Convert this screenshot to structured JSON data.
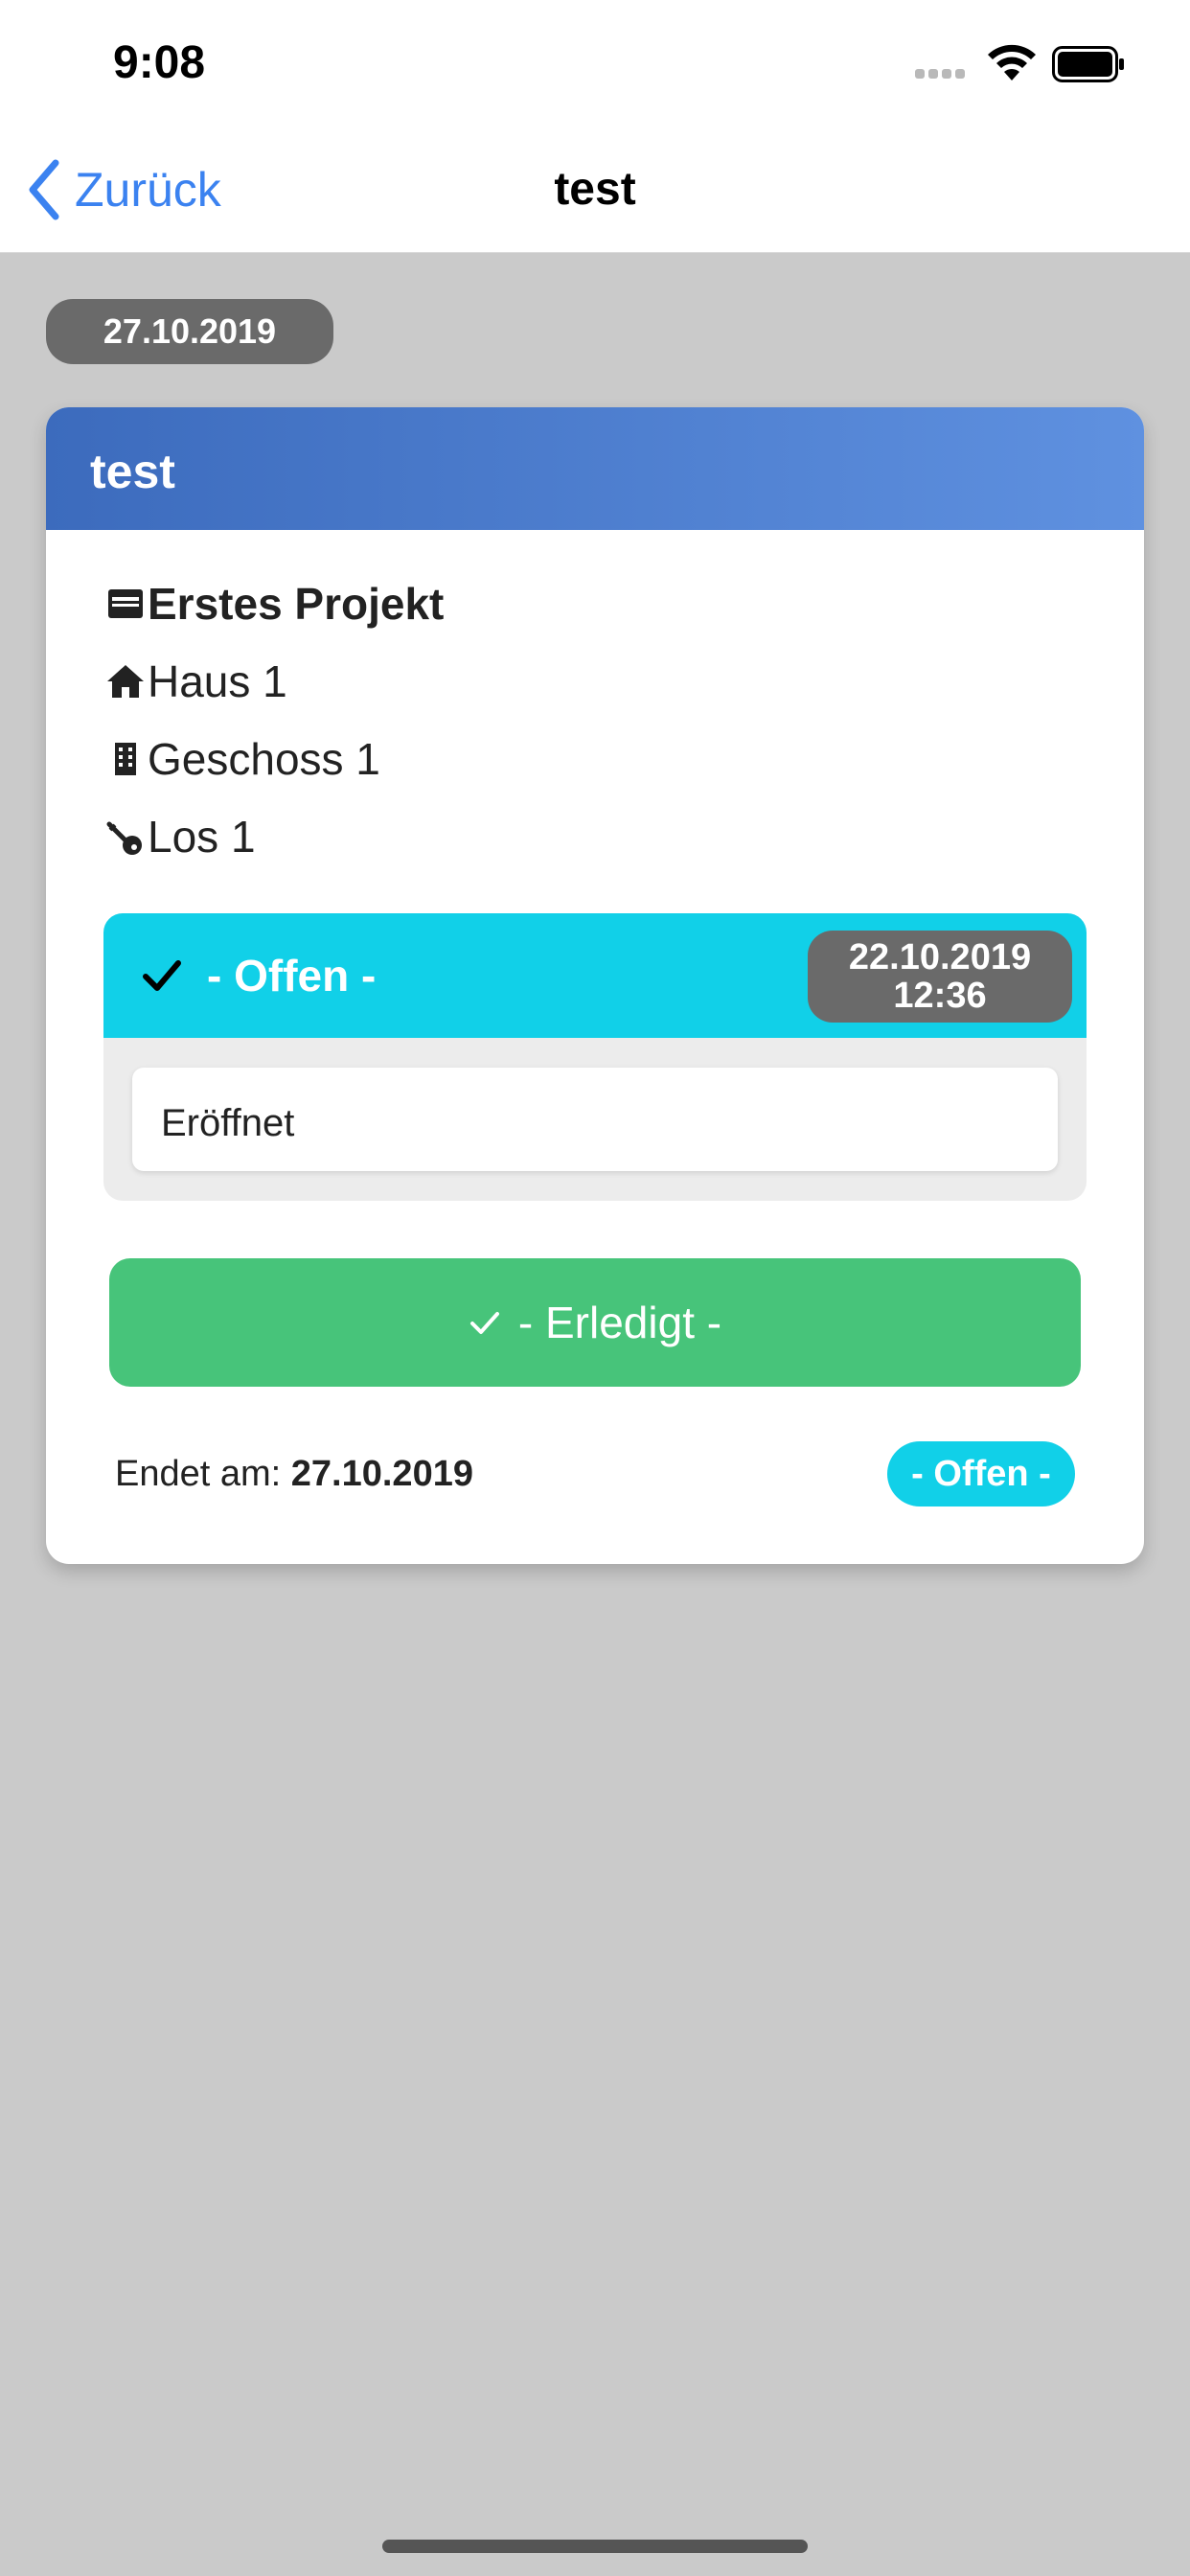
{
  "status_bar": {
    "time": "9:08"
  },
  "nav": {
    "back_label": "Zurück",
    "title": "test"
  },
  "date_badge": "27.10.2019",
  "card": {
    "title": "test",
    "project": "Erstes Projekt",
    "house": "Haus 1",
    "floor": "Geschoss 1",
    "lot": "Los 1",
    "status_entry": {
      "label": "- Offen -",
      "date": "22.10.2019",
      "time": "12:36",
      "note": "Eröffnet"
    },
    "done_button_label": "- Erledigt -",
    "end_label": "Endet am:",
    "end_date": "27.10.2019",
    "status_badge": "- Offen -"
  },
  "colors": {
    "accent_blue": "#3b82f0",
    "header_gradient_start": "#3c6bbd",
    "header_gradient_end": "#5f91e0",
    "status_cyan": "#11d0e8",
    "done_green": "#47c47a",
    "pill_gray": "#6a6a6a",
    "background": "#cacaca"
  },
  "icons": [
    "back-chevron-icon",
    "inbox-icon",
    "home-icon",
    "building-icon",
    "key-icon",
    "check-icon",
    "wifi-icon",
    "battery-icon"
  ]
}
